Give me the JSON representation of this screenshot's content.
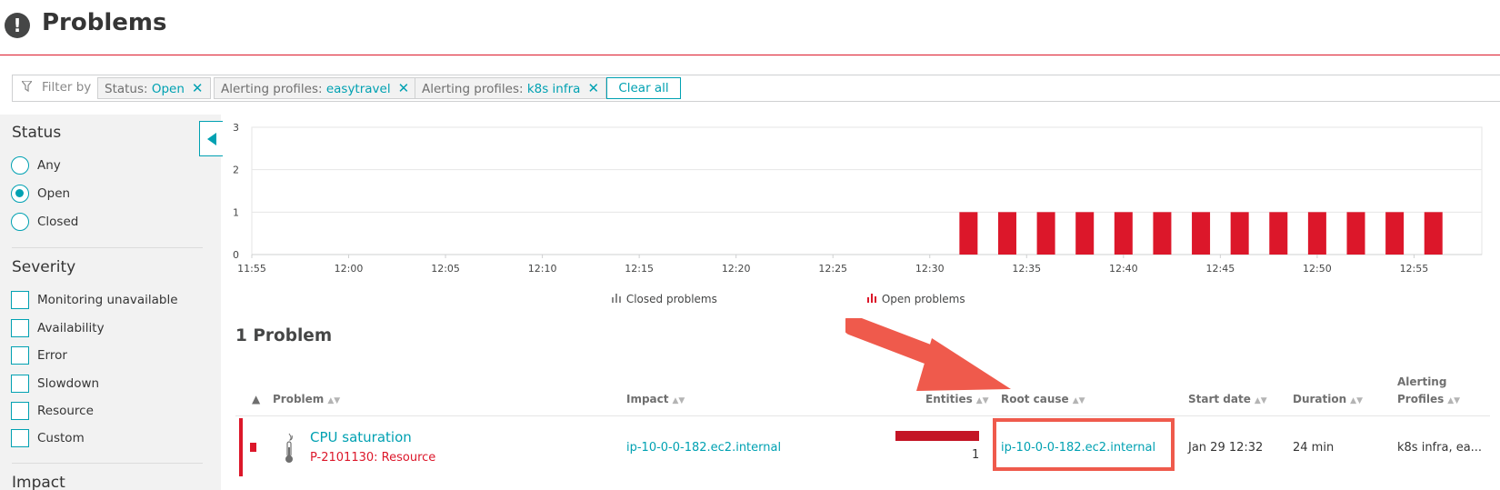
{
  "header": {
    "title": "Problems",
    "icon": "alert-circle-icon"
  },
  "filters": {
    "label": "Filter by",
    "chips": [
      {
        "key": "Status: ",
        "value": "Open"
      },
      {
        "key": "Alerting profiles: ",
        "value": "easytravel"
      },
      {
        "key": "Alerting profiles: ",
        "value": "k8s infra"
      }
    ],
    "clear_all": "Clear all"
  },
  "sidebar": {
    "status": {
      "title": "Status",
      "options": [
        "Any",
        "Open",
        "Closed"
      ],
      "selected": "Open"
    },
    "severity": {
      "title": "Severity",
      "options": [
        "Monitoring unavailable",
        "Availability",
        "Error",
        "Slowdown",
        "Resource",
        "Custom"
      ]
    },
    "impact": {
      "title": "Impact"
    }
  },
  "chart_data": {
    "type": "bar",
    "x_ticks": [
      "11:55",
      "12:00",
      "12:05",
      "12:10",
      "12:15",
      "12:20",
      "12:25",
      "12:30",
      "12:35",
      "12:40",
      "12:45",
      "12:50",
      "12:55"
    ],
    "y_ticks": [
      0,
      1,
      2,
      3
    ],
    "ylim": [
      0,
      3
    ],
    "series": [
      {
        "name": "Open problems",
        "color": "#dc172a",
        "x_minutes": [
          "12:32",
          "12:34",
          "12:36",
          "12:38",
          "12:40",
          "12:42",
          "12:44",
          "12:46",
          "12:48",
          "12:50",
          "12:52",
          "12:54",
          "12:56"
        ],
        "values": [
          1,
          1,
          1,
          1,
          1,
          1,
          1,
          1,
          1,
          1,
          1,
          1,
          1
        ]
      }
    ],
    "legend": [
      "Closed problems",
      "Open problems"
    ],
    "grid": true
  },
  "problems": {
    "heading": "1 Problem",
    "columns": [
      "Problem",
      "Impact",
      "Entities",
      "Root cause",
      "Start date",
      "Duration",
      "Alerting",
      "Profiles"
    ],
    "rows": [
      {
        "name": "CPU saturation",
        "id": "P-2101130: Resource",
        "impact": "ip-10-0-0-182.ec2.internal",
        "entities": "1",
        "root_cause": "ip-10-0-0-182.ec2.internal",
        "start_date": "Jan 29 12:32",
        "duration": "24 min",
        "alerting_profiles": "k8s infra, ea..."
      }
    ]
  }
}
